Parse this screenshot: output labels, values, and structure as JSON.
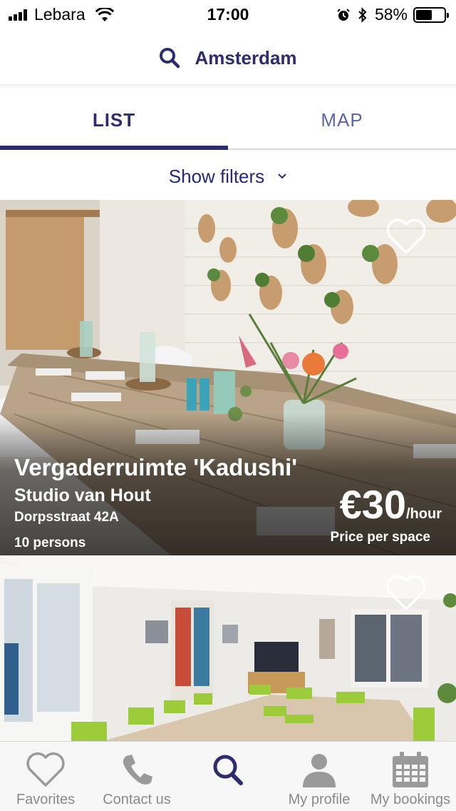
{
  "status_bar": {
    "carrier": "Lebara",
    "time": "17:00",
    "battery": "58%",
    "battery_level": 0.58,
    "icons": [
      "signal-icon",
      "wifi-icon",
      "alarm-icon",
      "bluetooth-icon",
      "battery-icon"
    ]
  },
  "search": {
    "city": "Amsterdam",
    "icon": "search-icon"
  },
  "tabs": [
    {
      "label": "LIST",
      "active": true
    },
    {
      "label": "MAP",
      "active": false
    }
  ],
  "filters": {
    "label": "Show filters",
    "icon": "chevron-down-icon"
  },
  "listings": [
    {
      "name": "Vergaderruimte 'Kadushi'",
      "venue": "Studio van Hout",
      "address": "Dorpsstraat 42A",
      "capacity": "10 persons",
      "price": "€30",
      "price_unit": "/hour",
      "price_note": "Price per space",
      "favorite_icon": "heart-outline-icon"
    },
    {
      "favorite_icon": "heart-outline-icon"
    }
  ],
  "bottom_nav": [
    {
      "label": "Favorites",
      "icon": "heart-icon",
      "active": false
    },
    {
      "label": "Contact us",
      "icon": "phone-icon",
      "active": false
    },
    {
      "label": "",
      "icon": "search-icon",
      "active": true
    },
    {
      "label": "My profile",
      "icon": "user-icon",
      "active": false
    },
    {
      "label": "My bookings",
      "icon": "calendar-icon",
      "active": false
    }
  ],
  "colors": {
    "primary": "#2d2c6e",
    "link": "#26287a",
    "tab_inactive": "#5e66a7",
    "nav_inactive": "#8a8a8a"
  }
}
